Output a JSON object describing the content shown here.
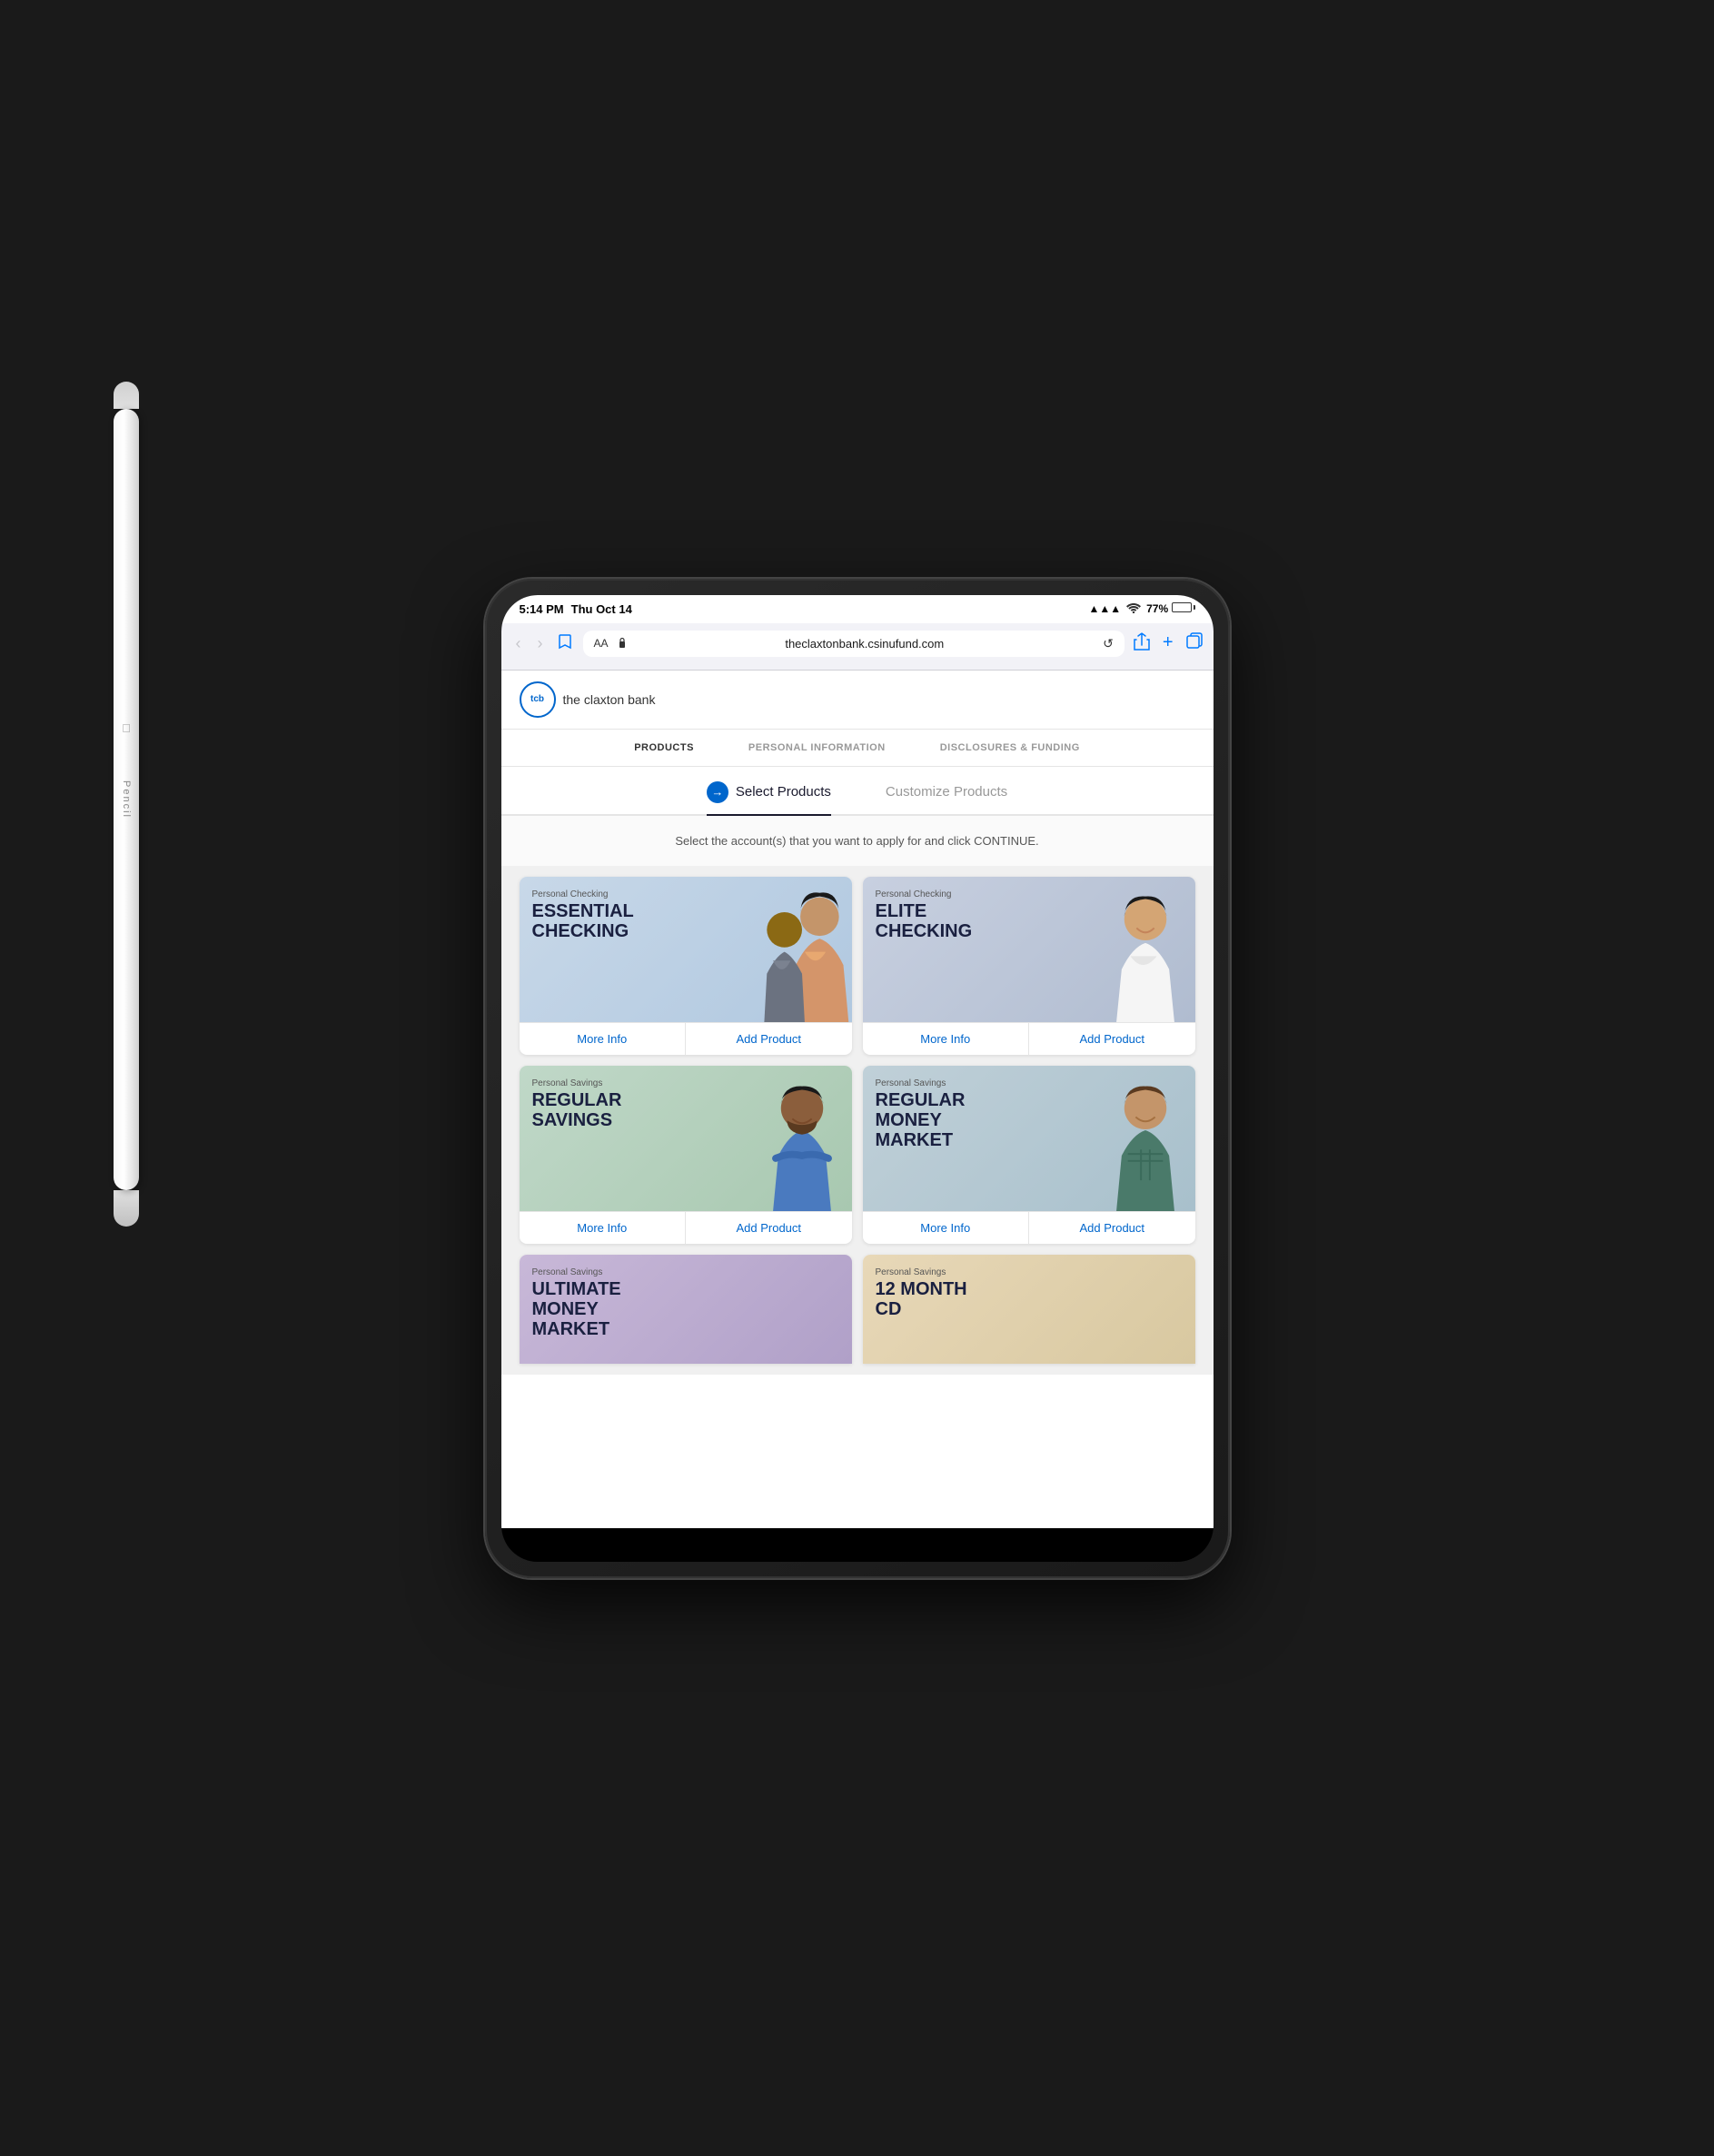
{
  "scene": {
    "background_color": "#1a1a1a"
  },
  "status_bar": {
    "time": "5:14 PM",
    "date": "Thu Oct 14",
    "signal": "●●●",
    "wifi": "wifi",
    "battery": "77%"
  },
  "browser": {
    "back_label": "‹",
    "forward_label": "›",
    "bookmark_icon": "book",
    "aa_label": "AA",
    "url": "theclaxtonbank.csinufund.com",
    "refresh_icon": "↺",
    "share_icon": "↑",
    "add_icon": "+",
    "tabs_icon": "⧉"
  },
  "bank": {
    "logo_text": "tcb",
    "name": "the claxton bank"
  },
  "progress_nav": {
    "steps": [
      {
        "label": "PRODUCTS",
        "active": true
      },
      {
        "label": "PERSONAL INFORMATION",
        "active": false
      },
      {
        "label": "DISCLOSURES & FUNDING",
        "active": false
      }
    ]
  },
  "sub_nav": {
    "items": [
      {
        "label": "Select Products",
        "active": true,
        "icon": "→"
      },
      {
        "label": "Customize Products",
        "active": false
      }
    ]
  },
  "instruction": "Select the account(s) that you want to apply for and click CONTINUE.",
  "products": [
    {
      "id": "essential-checking",
      "category": "Personal Checking",
      "name": "ESSENTIAL CHECKING",
      "bg_class": "checking-essential",
      "more_info_label": "More Info",
      "add_product_label": "Add Product"
    },
    {
      "id": "elite-checking",
      "category": "Personal Checking",
      "name": "ELITE CHECKING",
      "bg_class": "checking-elite",
      "more_info_label": "More Info",
      "add_product_label": "Add Product"
    },
    {
      "id": "regular-savings",
      "category": "Personal Savings",
      "name": "REGULAR SAVINGS",
      "bg_class": "savings-regular",
      "more_info_label": "More Info",
      "add_product_label": "Add Product"
    },
    {
      "id": "money-market",
      "category": "Personal Savings",
      "name": "REGULAR MONEY MARKET",
      "bg_class": "savings-money-market",
      "more_info_label": "More Info",
      "add_product_label": "Add Product"
    }
  ],
  "partial_products": [
    {
      "id": "ultimate-money-market",
      "category": "Personal Savings",
      "name": "ULTIMATE MONEY MARKET",
      "bg_class": "ultimate"
    },
    {
      "id": "12-month-cd",
      "category": "Personal Savings",
      "name": "12 MONTH CD",
      "bg_class": "cd"
    }
  ]
}
